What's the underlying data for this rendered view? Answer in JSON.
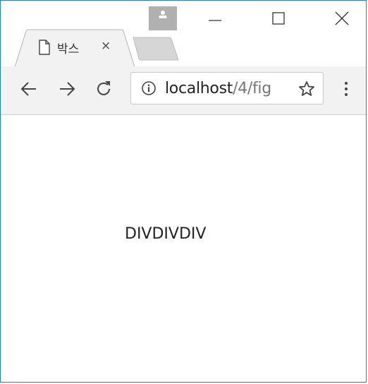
{
  "tab": {
    "title": "박스",
    "close_glyph": "×",
    "icon": "page-icon"
  },
  "toolbar": {
    "back_icon": "back-arrow-icon",
    "forward_icon": "forward-arrow-icon",
    "reload_icon": "reload-icon",
    "menu_icon": "more-vertical-icon"
  },
  "omnibox": {
    "host": "localhost",
    "path": "/4/fig",
    "info_icon": "info-icon",
    "bookmark_icon": "star-icon"
  },
  "window_controls": {
    "minimize": "minimize-icon",
    "maximize": "maximize-icon",
    "close": "close-icon"
  },
  "page": {
    "text": "DIVDIVDIV"
  }
}
